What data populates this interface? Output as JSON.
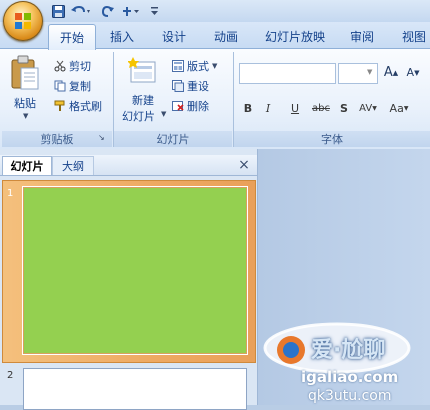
{
  "quick_access": {
    "save_icon": "save-icon",
    "undo_icon": "undo-icon",
    "redo_icon": "redo-icon",
    "customize_icon": "customize-qat-icon"
  },
  "tabs": [
    {
      "label": "开始",
      "active": true
    },
    {
      "label": "插入"
    },
    {
      "label": "设计"
    },
    {
      "label": "动画"
    },
    {
      "label": "幻灯片放映"
    },
    {
      "label": "审阅"
    },
    {
      "label": "视图"
    }
  ],
  "ribbon": {
    "clipboard": {
      "paste_label": "粘贴",
      "cut_label": "剪切",
      "copy_label": "复制",
      "format_painter_label": "格式刷",
      "group_label": "剪贴板"
    },
    "slides": {
      "new_slide_line1": "新建",
      "new_slide_line2": "幻灯片",
      "layout_label": "版式",
      "reset_label": "重设",
      "delete_label": "删除",
      "group_label": "幻灯片"
    },
    "font": {
      "font_name": "",
      "font_size": "",
      "grow_label": "A",
      "shrink_label": "A",
      "bold": "B",
      "italic": "I",
      "underline": "U",
      "strikethrough": "abc",
      "shadow": "S",
      "spacing": "AV",
      "case": "Aa",
      "group_label": "字体"
    }
  },
  "panel": {
    "tab_slides": "幻灯片",
    "tab_outline": "大纲",
    "close": "×",
    "slides": [
      {
        "number": "1",
        "fill": "#94d050"
      },
      {
        "number": "2",
        "fill": "#ffffff"
      }
    ]
  },
  "watermark": {
    "text1": "爱·尬聊",
    "text2": "igaliao.com",
    "text3": "qk3utu.com"
  },
  "colors": {
    "accent": "#15428b",
    "slide_fill": "#94d050",
    "selection": "#eea962"
  }
}
